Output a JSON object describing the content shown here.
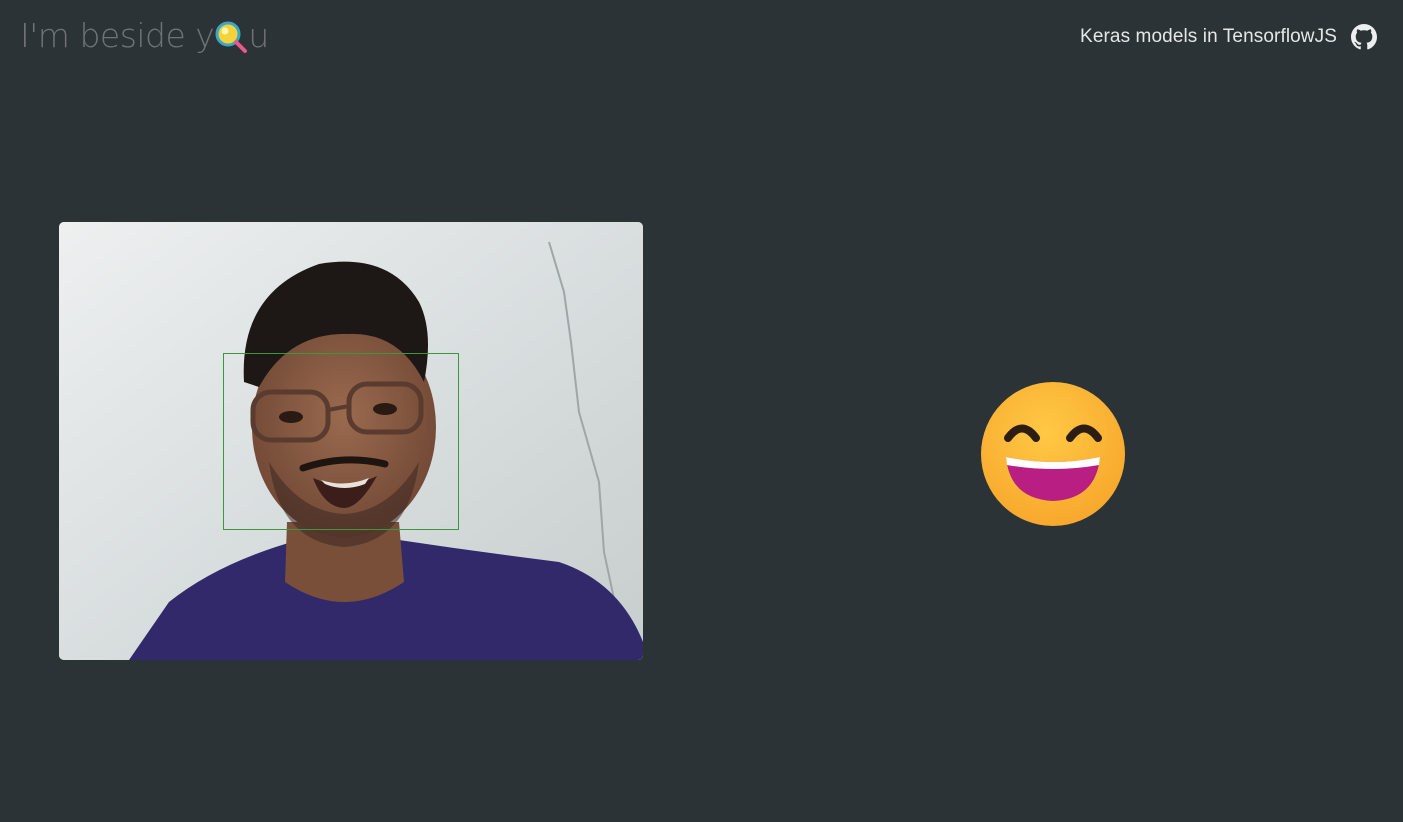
{
  "header": {
    "logo_text_before": "I'm beside y",
    "logo_text_after": "u",
    "nav_link": "Keras models in TensorflowJS",
    "github_icon": "github-icon"
  },
  "webcam": {
    "face_detection_color": "#3a9a3a"
  },
  "prediction": {
    "emotion": "happy",
    "emoji_icon": "grinning-face-with-smiling-eyes-icon"
  },
  "colors": {
    "background": "#2c3336",
    "logo_text": "#6f7375",
    "nav_text": "#e4e6e7"
  }
}
